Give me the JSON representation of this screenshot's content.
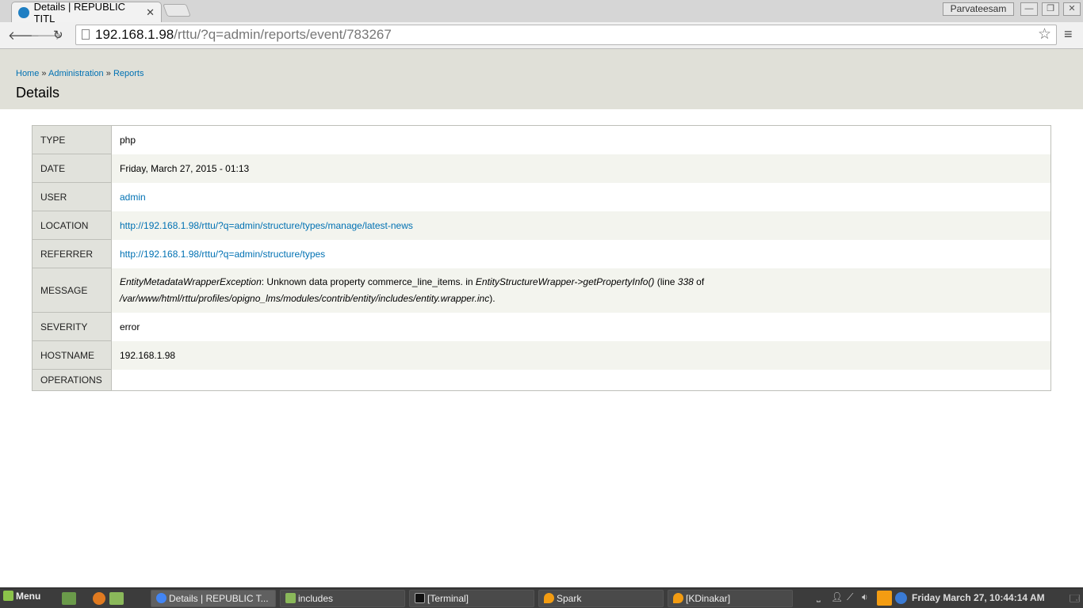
{
  "browser": {
    "tab_title": "Details | REPUBLIC TITL",
    "user": "Parvateesam",
    "url_host": "192.168.1.98",
    "url_path": "/rttu/?q=admin/reports/event/783267"
  },
  "breadcrumb": {
    "home": "Home",
    "admin": "Administration",
    "reports": "Reports",
    "sep": "»"
  },
  "page_title": "Details",
  "rows": {
    "type": {
      "label": "TYPE",
      "value": "php"
    },
    "date": {
      "label": "DATE",
      "value": "Friday, March 27, 2015 - 01:13"
    },
    "user": {
      "label": "USER",
      "value": "admin"
    },
    "location": {
      "label": "LOCATION",
      "value": "http://192.168.1.98/rttu/?q=admin/structure/types/manage/latest-news"
    },
    "referrer": {
      "label": "REFERRER",
      "value": "http://192.168.1.98/rttu/?q=admin/structure/types"
    },
    "message": {
      "label": "MESSAGE",
      "exception": "EntityMetadataWrapperException",
      "text1": ": Unknown data property commerce_line_items. in ",
      "method": "EntityStructureWrapper->getPropertyInfo()",
      "text2": " (line ",
      "line": "338",
      "text3": " of",
      "file": "/var/www/html/rttu/profiles/opigno_lms/modules/contrib/entity/includes/entity.wrapper.inc",
      "text4": ")."
    },
    "severity": {
      "label": "SEVERITY",
      "value": "error"
    },
    "hostname": {
      "label": "HOSTNAME",
      "value": "192.168.1.98"
    },
    "operations": {
      "label": "OPERATIONS",
      "value": ""
    }
  },
  "taskbar": {
    "menu": "Menu",
    "windows": [
      "Details | REPUBLIC T...",
      "includes",
      "[Terminal]",
      "Spark",
      "[KDinakar]"
    ],
    "clock": "Friday March 27, 10:44:14 AM"
  }
}
